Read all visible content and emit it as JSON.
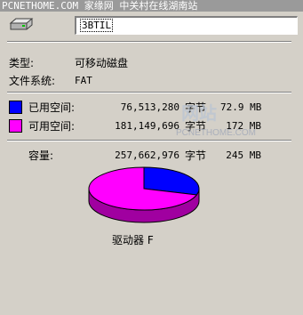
{
  "watermark": "PCNETHOME.COM 家缘网 中关村在线湖南站",
  "drive": {
    "name_value": "3BTIL",
    "icon": "drive-icon"
  },
  "info": [
    {
      "label": "类型:",
      "value": "可移动磁盘"
    },
    {
      "label": "文件系统:",
      "value": "FAT"
    }
  ],
  "used": {
    "label": "已用空间:",
    "bytes": "76,513,280",
    "unit": "字节",
    "size": "72.9 MB",
    "color": "#0000ff"
  },
  "free": {
    "label": "可用空间:",
    "bytes": "181,149,696",
    "unit": "字节",
    "size": "172 MB",
    "color": "#ff00ff"
  },
  "capacity": {
    "label": "容量:",
    "bytes": "257,662,976",
    "unit": "字节",
    "size": "245 MB"
  },
  "pie": {
    "used_fraction": 0.297,
    "used_color": "#0000ff",
    "free_color": "#ff00ff"
  },
  "drive_caption": "驱动器 F",
  "overlay_logo_text": "PCNETHOME.COM"
}
